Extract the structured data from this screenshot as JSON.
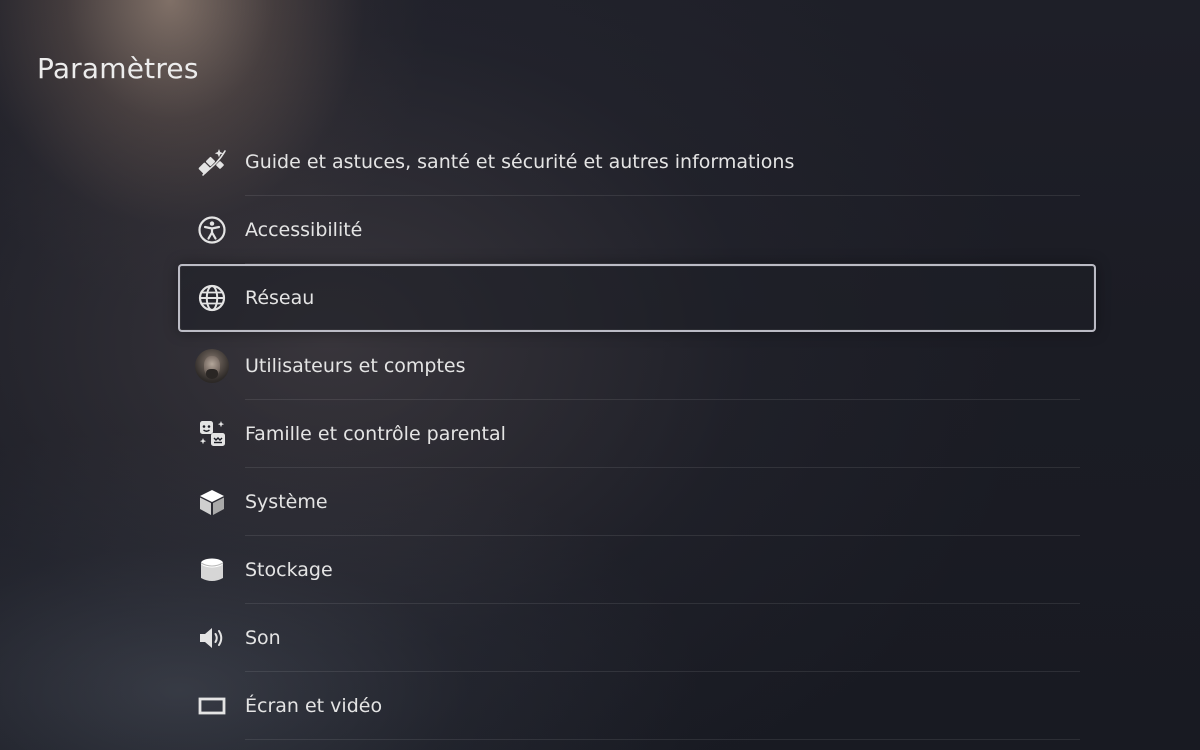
{
  "header": {
    "title": "Paramètres"
  },
  "menu": {
    "focused_index": 2,
    "items": [
      {
        "label": "Guide et astuces, santé et sécurité et autres informations",
        "icon": "tips-sparkle-icon"
      },
      {
        "label": "Accessibilité",
        "icon": "accessibility-icon"
      },
      {
        "label": "Réseau",
        "icon": "globe-icon"
      },
      {
        "label": "Utilisateurs et comptes",
        "icon": "user-avatar"
      },
      {
        "label": "Famille et contrôle parental",
        "icon": "family-icon"
      },
      {
        "label": "Système",
        "icon": "cube-icon"
      },
      {
        "label": "Stockage",
        "icon": "storage-cylinder-icon"
      },
      {
        "label": "Son",
        "icon": "speaker-icon"
      },
      {
        "label": "Écran et vidéo",
        "icon": "display-icon"
      }
    ]
  },
  "colors": {
    "text": "#e4e4e4",
    "focus_border": "#d7d7e1",
    "background": "#1b1c24"
  }
}
